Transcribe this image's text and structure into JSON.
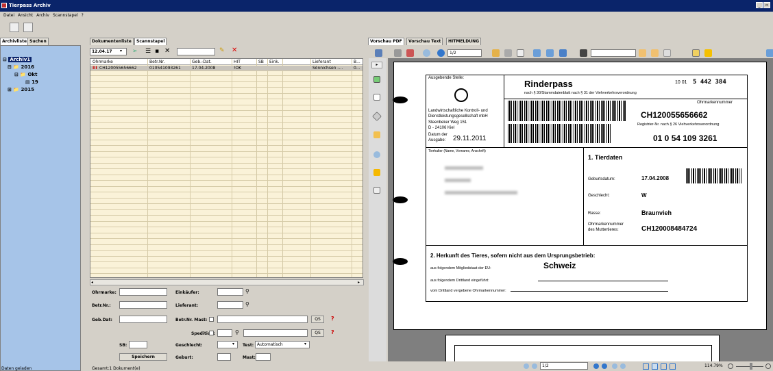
{
  "window": {
    "title": "Tierpass Archiv",
    "min_btn": "_",
    "max_btn": "▫",
    "close_btn": "x"
  },
  "menu": [
    "Datei",
    "Ansicht",
    "Archiv",
    "Scannstapel",
    "?"
  ],
  "left_tabs": [
    "Archivliste",
    "Suchen"
  ],
  "tree": {
    "root": "Archiv1",
    "y2016": "2016",
    "okt": "Okt",
    "d19": "19",
    "y2015": "2015"
  },
  "mid_tabs": [
    "Dokumentenliste",
    "Scannstapel"
  ],
  "list_toolbar": {
    "date": "12.04.17"
  },
  "columns": [
    "Ohrmarke",
    "Betr.Nr.",
    "Geb.-Dat.",
    "HIT",
    "SB",
    "Eink.",
    "Lieferant",
    "B..."
  ],
  "rows": [
    {
      "ohrmarke": "CH120055656662",
      "betr": "010541093261",
      "geb": "17.04.2008",
      "hit": "!OK",
      "sb": "",
      "eink": "",
      "lieferant": "Sönnichsen -...",
      "b": "0..."
    }
  ],
  "form": {
    "ohrmarke": "Ohrmarke:",
    "betrnr": "Betr.Nr.:",
    "gebdat": "Geb.Dat:",
    "sb": "SB:",
    "einkaeufer": "Einkäufer:",
    "lieferant": "Lieferant:",
    "betrnr_mast": "Betr.Nr. Mast:",
    "spedition": "Spedition:",
    "geschlecht": "Geschlecht:",
    "geburt": "Geburt:",
    "test": "Test:",
    "test_value": "Automatisch",
    "mast": "Mast:",
    "save": "Speichern",
    "qs": "QS",
    "q": "?"
  },
  "right_tabs": [
    "Vorschau PDF",
    "Vorschau Text",
    "HITMELDUNG"
  ],
  "pdf_toolbar": {
    "page": "1/2"
  },
  "status_left": "Daten geladen",
  "status_mid": "Gesamt:1 Dokument(e)",
  "pdf_status": {
    "page": "1/2",
    "zoom": "114.79%"
  },
  "doc": {
    "ausgebende": "Ausgebende Stelle:",
    "title": "Rinderpass",
    "subtitle": "nach § 30/Stammdatenblatt nach § 31 der Viehverkehrsverordnung",
    "serial_small": "10 01",
    "serial": "5 442 384",
    "ohrmarkennummer": "Ohrmarkennummer",
    "ear_tag": "CH120055656662",
    "registrier": "Registrier-Nr. nach § 26 Viehverkehrsverordnung",
    "reg_nr": "01 0 54 109 3261",
    "issuer1": "Landwirtschaftliche Kontroll- und",
    "issuer2": "Dienstleistungsgesellschaft mbH",
    "issuer3": "Steenbeker Weg 151",
    "issuer4": "D - 24106 Kiel",
    "datum_label1": "Datum der",
    "datum_label2": "Ausgabe:",
    "datum": "29.11.2011",
    "tierhalter": "Tierhalter (Name, Vorname, Anschrift)",
    "tierdaten": "1. Tierdaten",
    "geburtsdatum_label": "Geburtsdatum:",
    "geburtsdatum": "17.04.2008",
    "geschlecht_label": "Geschlecht:",
    "geschlecht": "W",
    "rasse_label": "Rasse:",
    "rasse": "Braunvieh",
    "mutter_label1": "Ohrmarkennummer",
    "mutter_label2": "des Muttertieres:",
    "mutter": "CH120008484724",
    "herkunft": "2. Herkunft des Tieres, sofern nicht aus dem Ursprungsbetrieb:",
    "mitglied": "aus folgendem Mitgliedstaat der EU:",
    "land": "Schweiz",
    "dritt": "aus folgendem Drittland eingeführt:",
    "vergeben": "vom Drittland vergebene Ohrmarkennummer:"
  },
  "colors": {
    "title_bg": "#0a246a",
    "tree_bg": "#a6c4e8",
    "list_bg": "#faf2d8"
  }
}
